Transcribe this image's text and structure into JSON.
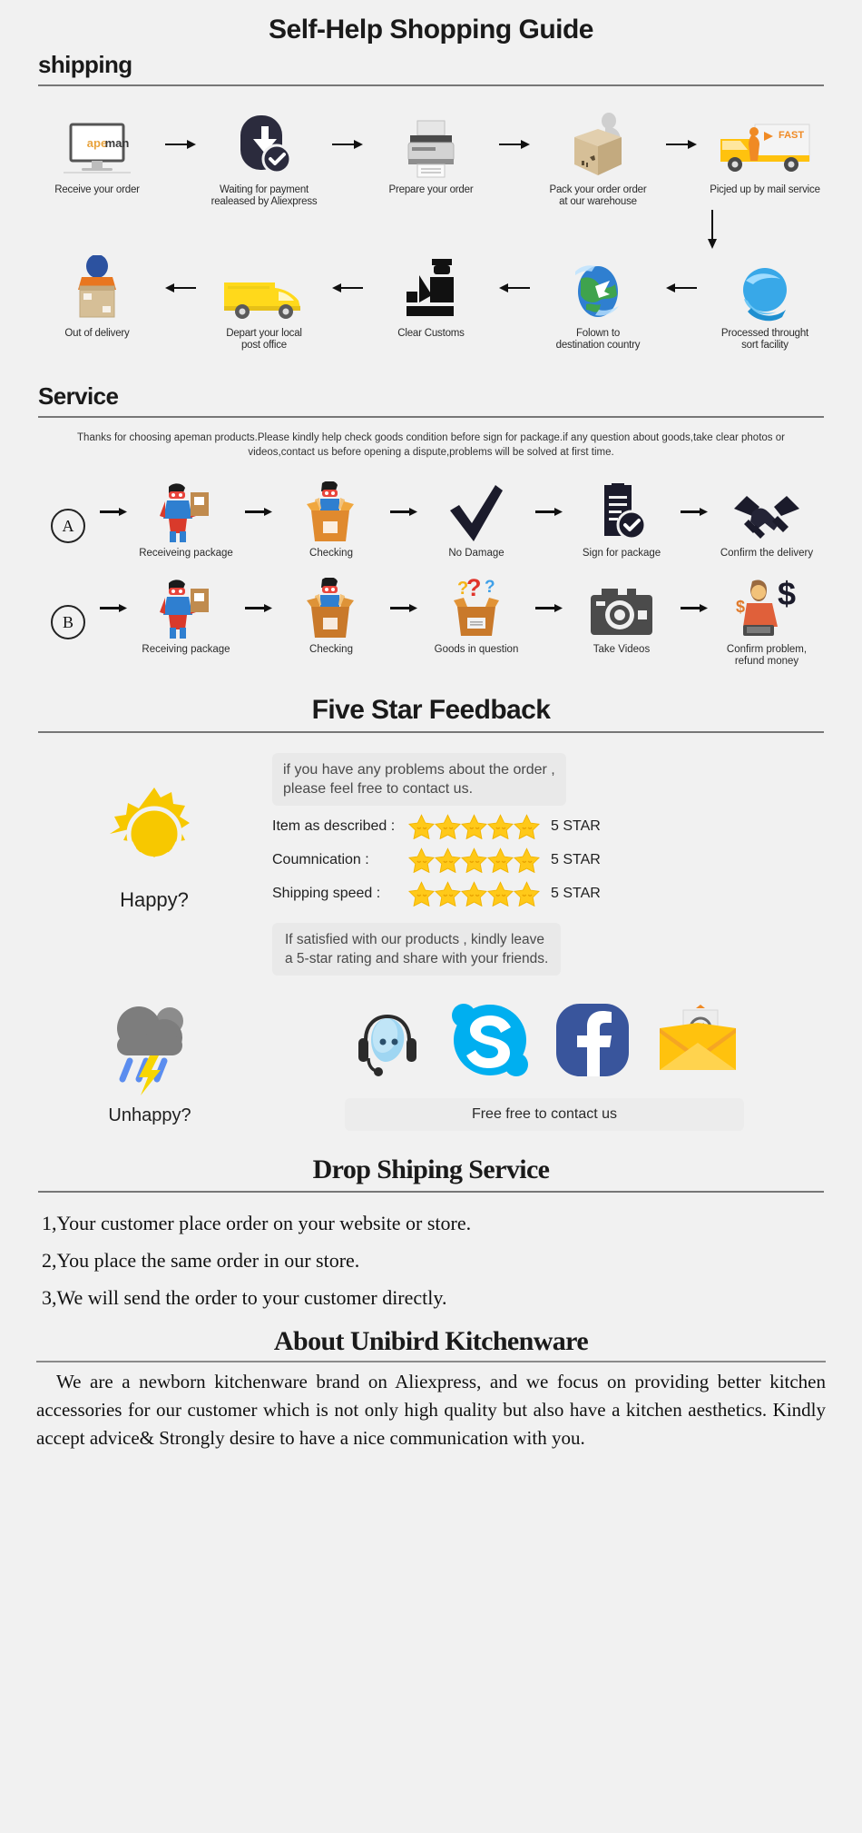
{
  "title": "Self-Help Shopping Guide",
  "sections": {
    "shipping": {
      "heading": "shipping"
    },
    "service": {
      "heading": "Service",
      "note": "Thanks for choosing apeman products.Please kindly help check goods condition before sign for package.if any question about goods,take clear photos or videos,contact us before opening a dispute,problems will be solved at first time."
    },
    "feedback": {
      "heading": "Five Star Feedback"
    },
    "dropship": {
      "heading": "Drop Shiping Service"
    },
    "about": {
      "heading": "About Unibird Kitchenware",
      "body": "We are a newborn kitchenware brand on Aliexpress, and we focus on providing better kitchen accessories for our customer which is not only high quality but also have a kitchen aesthetics. Kindly accept advice& Strongly desire to have a nice communication with you."
    }
  },
  "shipping_row1": [
    {
      "icon": "monitor-icon",
      "label": "Receive your order",
      "brand": "apeman"
    },
    {
      "icon": "payment-shield-icon",
      "label": "Waiting for payment\nrealeased by Aliexpress"
    },
    {
      "icon": "printer-icon",
      "label": "Prepare your order"
    },
    {
      "icon": "packing-box-icon",
      "label": "Pack your order order\nat our warehouse"
    },
    {
      "icon": "delivery-truck-icon",
      "label": "Picjed up by mail service",
      "badge": "FAST"
    }
  ],
  "shipping_row2": [
    {
      "icon": "out-for-delivery-icon",
      "label": "Out of delivery"
    },
    {
      "icon": "post-van-icon",
      "label": "Depart your local\npost office"
    },
    {
      "icon": "customs-officer-icon",
      "label": "Clear Customs"
    },
    {
      "icon": "globe-plane-icon",
      "label": "Folown to\ndestination country"
    },
    {
      "icon": "sort-facility-icon",
      "label": "Processed throught\nsort facility"
    }
  ],
  "service_row_a": {
    "badge": "A",
    "steps": [
      {
        "icon": "hero-with-package-icon",
        "label": "Receiveing package"
      },
      {
        "icon": "hero-in-box-icon",
        "label": "Checking"
      },
      {
        "icon": "check-mark-icon",
        "label": "No Damage"
      },
      {
        "icon": "signed-document-icon",
        "label": "Sign for package"
      },
      {
        "icon": "handshake-icon",
        "label": "Confirm the delivery"
      }
    ]
  },
  "service_row_b": {
    "badge": "B",
    "steps": [
      {
        "icon": "hero-with-package-icon",
        "label": "Receiving package"
      },
      {
        "icon": "hero-in-box-icon",
        "label": "Checking"
      },
      {
        "icon": "question-box-icon",
        "label": "Goods in question"
      },
      {
        "icon": "camera-icon",
        "label": "Take Videos"
      },
      {
        "icon": "refund-agent-icon",
        "label": "Confirm problem,\nrefund money"
      }
    ]
  },
  "feedback": {
    "mood_happy": "Happy?",
    "bubble_top": "if you have any problems about the order ,\nplease feel free to contact us.",
    "ratings": [
      {
        "label": "Item as described :",
        "stars": 5,
        "value": "5 STAR"
      },
      {
        "label": "Coumnication :",
        "stars": 5,
        "value": "5 STAR"
      },
      {
        "label": "Shipping speed :",
        "stars": 5,
        "value": "5 STAR"
      }
    ],
    "bubble_bottom": "If satisfied with our products ,  kindly leave\na 5-star rating and share with your friends.",
    "star_color": "#FFC919"
  },
  "contact": {
    "mood_unhappy": "Unhappy?",
    "channels": [
      {
        "icon": "support-headset-icon",
        "name": "Live Support"
      },
      {
        "icon": "skype-icon",
        "name": "Skype"
      },
      {
        "icon": "facebook-icon",
        "name": "Facebook"
      },
      {
        "icon": "email-icon",
        "name": "Email"
      }
    ],
    "button_label": "Free free to contact us"
  },
  "dropship_steps": [
    "1,Your customer place order on your website or store.",
    "2,You place the same order in our store.",
    "3,We will send the order to your customer directly."
  ],
  "colors": {
    "background": "#f1f1f1",
    "rule": "#7d7d7d",
    "star": "#FFC919",
    "skype": "#00AFF0",
    "facebook": "#3b5998",
    "sun": "#F7C800",
    "cloud": "#7d7d7d",
    "truck": "#FFC20E"
  }
}
